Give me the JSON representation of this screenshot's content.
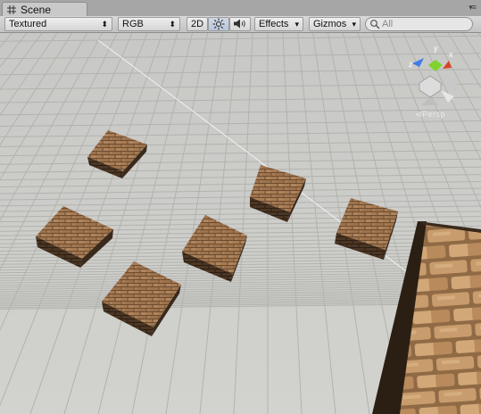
{
  "window": {
    "tab_label": "Scene",
    "tab_icon": "grid-icon"
  },
  "toolbar": {
    "draw_mode": "Textured",
    "render_mode": "RGB",
    "toggle_2d": "2D",
    "lighting_icon": "sun-icon",
    "audio_icon": "speaker-icon",
    "effects": "Effects",
    "gizmos": "Gizmos",
    "search_placeholder": "All"
  },
  "gizmo": {
    "axis_x": "x",
    "axis_y": "y",
    "axis_z": "z",
    "projection_label": "Persp",
    "colors": {
      "x": "#d9432b",
      "y": "#7fd32a",
      "z": "#3f7ee6"
    }
  },
  "scene": {
    "object_count": 7,
    "material": "brick",
    "colors": {
      "ground": "#cfcfcb",
      "grid": "#b2b2ae",
      "brick": "#a57b54",
      "brick_dark": "#3c2c1e"
    }
  }
}
